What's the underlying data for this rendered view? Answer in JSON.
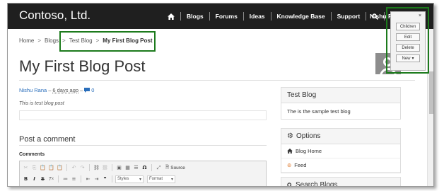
{
  "brand": "Contoso, Ltd.",
  "nav": {
    "items": [
      "Blogs",
      "Forums",
      "Ideas",
      "Knowledge Base",
      "Support"
    ],
    "user": "Nishu Rana"
  },
  "breadcrumb": {
    "home": "Home",
    "blogs": "Blogs",
    "blog": "Test Blog",
    "current": "My First Blog Post",
    "separator": ">"
  },
  "post": {
    "title": "My First Blog Post",
    "author": "Nishu Rana",
    "date": "6 days ago",
    "comment_count": "0",
    "summary": "This is test blog post"
  },
  "comment_form": {
    "heading": "Post a comment",
    "label": "Comments",
    "toolbar": {
      "source_label": "Source",
      "styles_label": "Styles",
      "format_label": "Format"
    }
  },
  "sidebar": {
    "blog_panel": {
      "title": "Test Blog",
      "description": "The is the sample test blog"
    },
    "options_panel": {
      "title": "Options",
      "links": [
        "Blog Home",
        "Feed"
      ]
    },
    "search_panel": {
      "title": "Search Blogs"
    }
  },
  "action_panel": {
    "close_label": "×",
    "buttons": [
      "Children",
      "Edit",
      "Delete",
      "New"
    ]
  },
  "colors": {
    "navbar": "#1f1f1f",
    "link": "#2a6ebb",
    "highlight": "#1c7a1c"
  }
}
